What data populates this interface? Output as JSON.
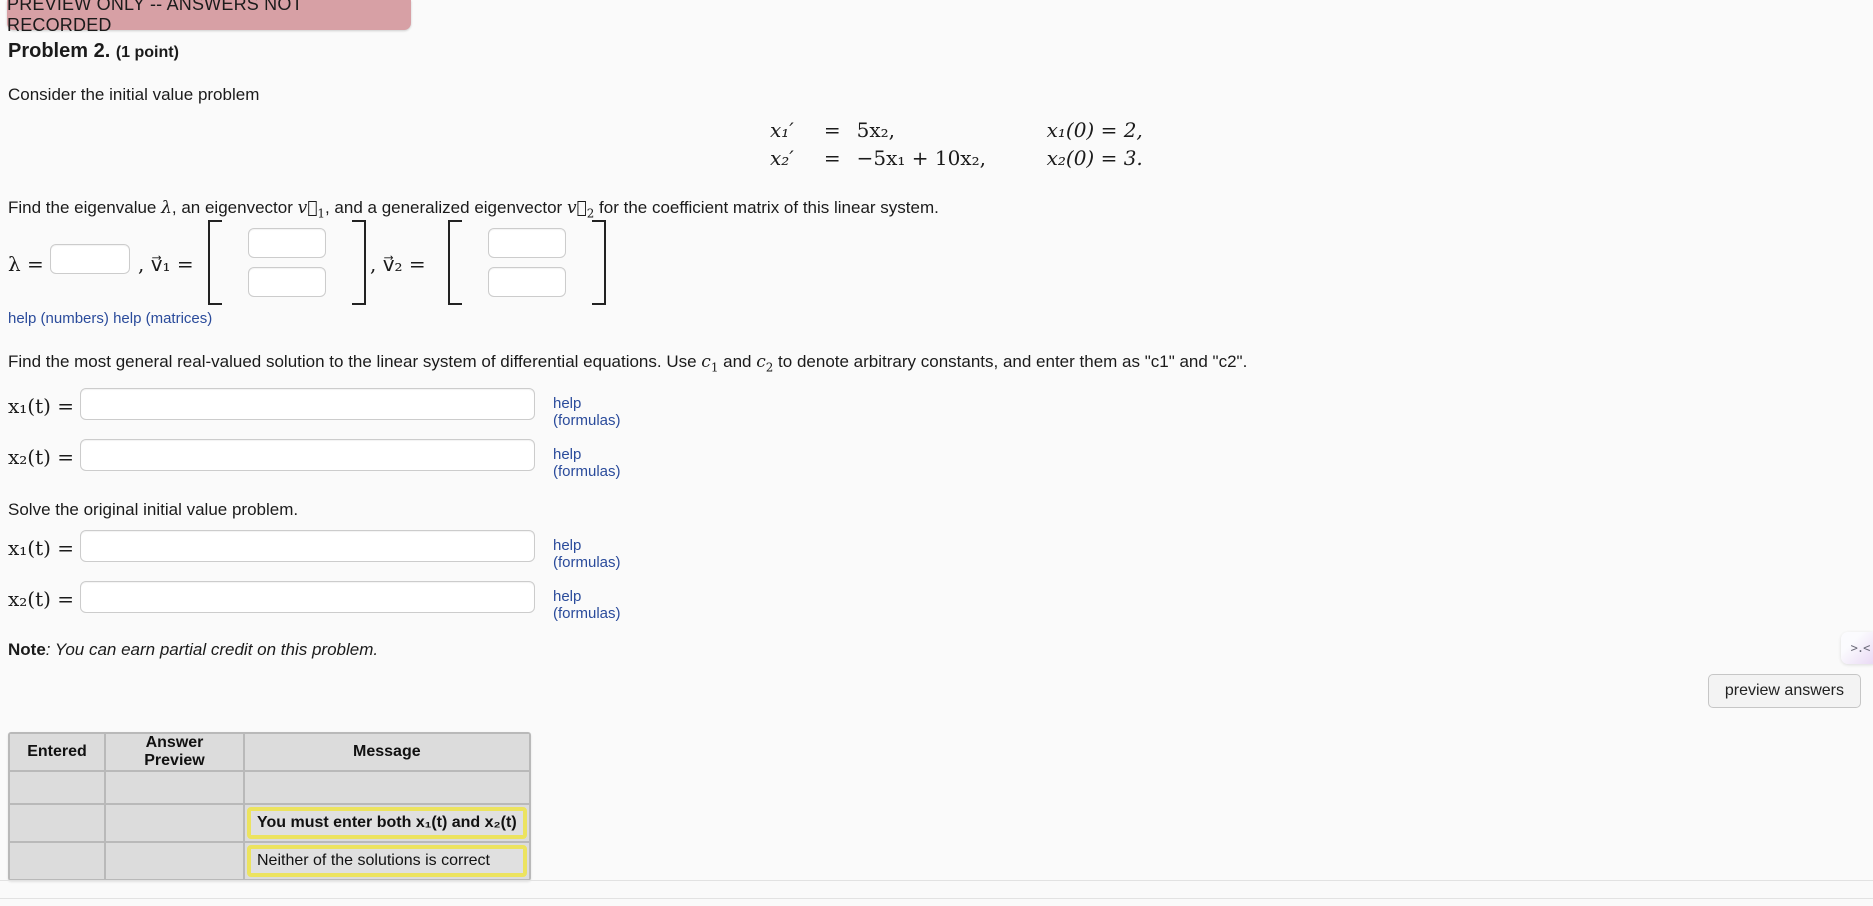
{
  "banner": {
    "text": "PREVIEW ONLY -- ANSWERS NOT RECORDED",
    "color": "#d7a0a5"
  },
  "problem": {
    "title": "Problem 2.",
    "points": "(1 point)"
  },
  "paragraphs": {
    "consider": "Consider the initial value problem",
    "find_eigen_pre": "Find the eigenvalue ",
    "find_eigen_mid1": ", an eigenvector ",
    "find_eigen_mid2": ", and a generalized eigenvector ",
    "find_eigen_post": " for the coefficient matrix of this linear system.",
    "general_pre": "Find the most general real-valued solution to the linear system of differential equations. Use ",
    "general_mid": " and ",
    "general_post": " to denote arbitrary constants, and enter them as \"c1\" and \"c2\".",
    "solve": "Solve the original initial value problem.",
    "note_label": "Note",
    "note_text": ": You can earn partial credit on this problem."
  },
  "system": {
    "rows": [
      {
        "lhs": "x₁′",
        "eq": "=",
        "rhs": "5x₂,",
        "initial": "x₁(0) = 2,"
      },
      {
        "lhs": "x₂′",
        "eq": "=",
        "rhs": "−5x₁ + 10x₂,",
        "initial": "x₂(0) = 3."
      }
    ]
  },
  "eigen": {
    "lambda_label": "λ =",
    "lambda_value": "",
    "v1_label": ", v⃗₁ =",
    "v2_label": ", v⃗₂ =",
    "v1_values": [
      "",
      ""
    ],
    "v2_values": [
      "",
      ""
    ]
  },
  "help_links": {
    "numbers": "help (numbers)",
    "matrices": "help (matrices)",
    "formulas": "help (formulas)"
  },
  "solution_rows": [
    {
      "label": "x₁(t) =",
      "value": "",
      "help": "help (formulas)"
    },
    {
      "label": "x₂(t) =",
      "value": "",
      "help": "help (formulas)"
    },
    {
      "label": "x₁(t) =",
      "value": "",
      "help": "help (formulas)"
    },
    {
      "label": "x₂(t) =",
      "value": "",
      "help": "help (formulas)"
    }
  ],
  "buttons": {
    "preview_answers": "preview answers"
  },
  "kaomoji": {
    "glyph": ">.<"
  },
  "results_table": {
    "headers": [
      "Entered",
      "Answer Preview",
      "Message"
    ],
    "rows": [
      {
        "entered": "",
        "preview": "",
        "message": "",
        "highlighted": false,
        "bold": false
      },
      {
        "entered": "",
        "preview": "",
        "message": "You must enter both x₁(t) and x₂(t)",
        "highlighted": true,
        "bold": true
      },
      {
        "entered": "",
        "preview": "",
        "message": "Neither of the solutions is correct",
        "highlighted": true,
        "bold": false
      }
    ]
  }
}
